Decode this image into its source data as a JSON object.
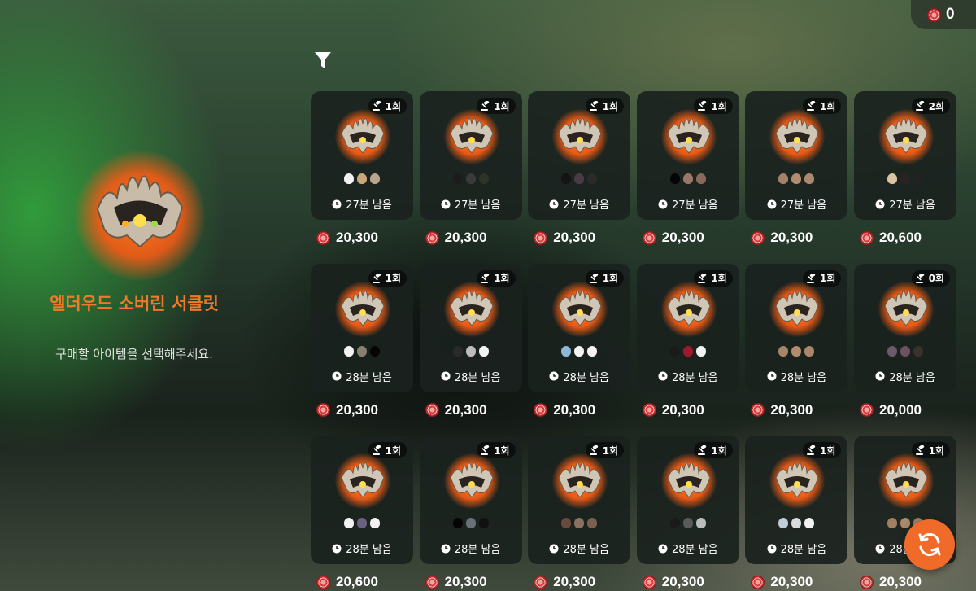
{
  "currency": {
    "balance": "0",
    "icon": "coin-icon"
  },
  "selected_item": {
    "name": "엘더우드 소버린 서클릿",
    "hint": "구매할 아이템을 선택해주세요."
  },
  "toolbar": {
    "filter_icon": "filter-icon",
    "refresh_icon": "refresh-icon"
  },
  "colors": {
    "accent": "#f06a2a",
    "title": "#f07a2a",
    "card_bg": "#1a221e"
  },
  "listings": [
    {
      "count": "1회",
      "time": "27분 남음",
      "price": "20,300",
      "colors": [
        "#f2f2f2",
        "#c9a77a",
        "#b8a58a"
      ]
    },
    {
      "count": "1회",
      "time": "27분 남음",
      "price": "20,300",
      "colors": [
        "#1c1c1c",
        "#3a3a3a",
        "#2e3328"
      ]
    },
    {
      "count": "1회",
      "time": "27분 남음",
      "price": "20,300",
      "colors": [
        "#141414",
        "#4a3a44",
        "#2a2a2a"
      ]
    },
    {
      "count": "1회",
      "time": "27분 남음",
      "price": "20,300",
      "colors": [
        "#050505",
        "#9a7766",
        "#8a6a5a"
      ]
    },
    {
      "count": "1회",
      "time": "27분 남음",
      "price": "20,300",
      "colors": [
        "#a2836a",
        "#b08c70",
        "#a98a6e"
      ]
    },
    {
      "count": "2회",
      "time": "27분 남음",
      "price": "20,600",
      "colors": [
        "#d9c4a0",
        "#2a2420",
        "#222222"
      ]
    },
    {
      "count": "1회",
      "time": "28분 남음",
      "price": "20,300",
      "colors": [
        "#f2f2f2",
        "#8a7e70",
        "#050505"
      ]
    },
    {
      "count": "1회",
      "time": "28분 남음",
      "price": "20,300",
      "colors": [
        "#2a2a2a",
        "#bcbcbc",
        "#f2f2f2"
      ]
    },
    {
      "count": "1회",
      "time": "28분 남음",
      "price": "20,300",
      "colors": [
        "#8eb8d8",
        "#f2f2f2",
        "#f2f2f2"
      ]
    },
    {
      "count": "1회",
      "time": "28분 남음",
      "price": "20,300",
      "colors": [
        "#1a1a1a",
        "#9c1a2e",
        "#f2f2f2"
      ]
    },
    {
      "count": "1회",
      "time": "28분 남음",
      "price": "20,300",
      "colors": [
        "#a88466",
        "#b18c6c",
        "#a9876a"
      ]
    },
    {
      "count": "0회",
      "time": "28분 남음",
      "price": "20,000",
      "colors": [
        "#6a5a6a",
        "#6e5060",
        "#3a302c"
      ]
    },
    {
      "count": "1회",
      "time": "28분 남음",
      "price": "20,600",
      "colors": [
        "#f2f2f2",
        "#6a6080",
        "#f2f2f2"
      ]
    },
    {
      "count": "1회",
      "time": "28분 남음",
      "price": "20,300",
      "colors": [
        "#050505",
        "#6a7078",
        "#111111"
      ]
    },
    {
      "count": "1회",
      "time": "28분 남음",
      "price": "20,300",
      "colors": [
        "#6a4a3a",
        "#8a7060",
        "#7a6050"
      ]
    },
    {
      "count": "1회",
      "time": "28분 남음",
      "price": "20,300",
      "colors": [
        "#1a1a1a",
        "#5a5a5a",
        "#bcbcbc"
      ]
    },
    {
      "count": "1회",
      "time": "28분 남음",
      "price": "20,300",
      "colors": [
        "#c0ccd8",
        "#dadada",
        "#f2f2f2"
      ]
    },
    {
      "count": "1회",
      "time": "28분 남음",
      "price": "20,300",
      "colors": [
        "#a08060",
        "#a88a6c",
        "#a08262"
      ]
    }
  ]
}
